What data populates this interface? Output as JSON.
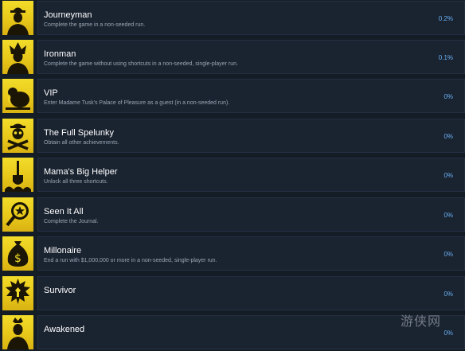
{
  "achievements": [
    {
      "title": "Journeyman",
      "description": "Complete the game in a non-seeded run.",
      "percent": "0.2%",
      "icon": "explorer-icon"
    },
    {
      "title": "Ironman",
      "description": "Complete the game without using shortcuts in a non-seeded, single-player run.",
      "percent": "0.1%",
      "icon": "spiky-hair-icon"
    },
    {
      "title": "VIP",
      "description": "Enter Madame Tusk's Palace of Pleasure as a guest (in a non-seeded run).",
      "percent": "0%",
      "icon": "madame-tusk-icon"
    },
    {
      "title": "The Full Spelunky",
      "description": "Obtain all other achievements.",
      "percent": "0%",
      "icon": "skull-crossbones-icon"
    },
    {
      "title": "Mama's Big Helper",
      "description": "Unlock all three shortcuts.",
      "percent": "0%",
      "icon": "shovel-icon"
    },
    {
      "title": "Seen It All",
      "description": "Complete the Journal.",
      "percent": "0%",
      "icon": "magnifier-icon"
    },
    {
      "title": "Millonaire",
      "description": "End a run with $1,000,000 or more in a non-seeded, single-player run.",
      "percent": "0%",
      "icon": "money-bag-icon"
    },
    {
      "title": "Survivor",
      "description": "",
      "percent": "0%",
      "icon": "survivor-icon"
    },
    {
      "title": "Awakened",
      "description": "",
      "percent": "0%",
      "icon": "awakened-icon"
    }
  ],
  "watermark": {
    "text": "游侠网"
  },
  "colors": {
    "background": "#141c26",
    "panel": "#1a2330",
    "percent": "#6ab0f3",
    "icon": "#f2dc2a"
  }
}
